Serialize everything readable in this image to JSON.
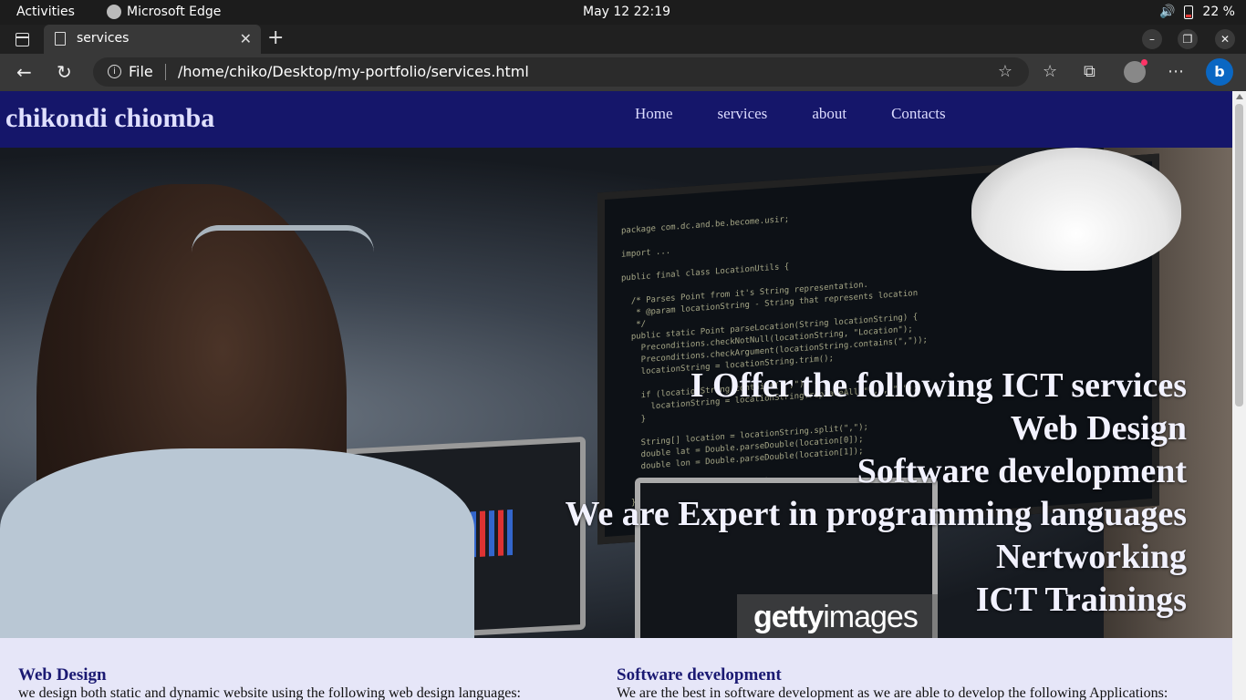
{
  "system": {
    "activities": "Activities",
    "app_name": "Microsoft Edge",
    "clock": "May 12  22:19",
    "battery": "22 %"
  },
  "browser": {
    "tab_title": "services",
    "address_label": "File",
    "url": "/home/chiko/Desktop/my-portfolio/services.html"
  },
  "site": {
    "brand": "chikondi chiomba",
    "nav": [
      "Home",
      "services",
      "about",
      "Contacts"
    ],
    "hero_lines": [
      "I Offer the following ICT services",
      "Web Design",
      "Software development",
      "We are Expert in programming languages",
      "Nertworking",
      "ICT Trainings"
    ],
    "hero_watermark": {
      "bold": "getty",
      "light": "images"
    },
    "sections": [
      {
        "title": "Web Design",
        "text": "we design both static and dynamic website using the following web design languages:"
      },
      {
        "title": "Software development",
        "text": "We are the best in software development as we are able to develop the following Applications:"
      }
    ]
  },
  "colors": {
    "header_bg": "#15166a",
    "page_bg": "#e6e6f8",
    "section_title": "#1b1a73"
  },
  "icons": [
    "edge-icon",
    "volume-icon",
    "battery-icon",
    "tab-actions-icon",
    "document-icon",
    "close-icon",
    "plus-icon",
    "back-icon",
    "refresh-icon",
    "info-icon",
    "add-favorite-icon",
    "favorites-icon",
    "collections-icon",
    "profile-icon",
    "more-icon",
    "bing-icon"
  ]
}
